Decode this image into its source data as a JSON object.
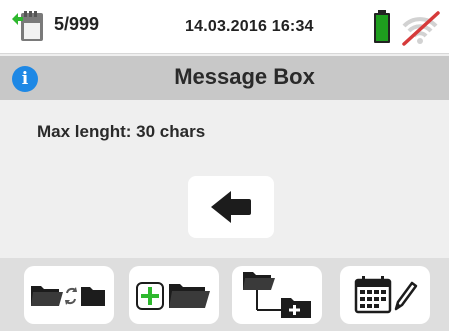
{
  "status_bar": {
    "memory_icon": "sd-card-save-icon",
    "memory_count": "5/999",
    "datetime": "14.03.2016  16:34",
    "battery_icon": "battery-full-icon",
    "battery_color": "#1e9e1e",
    "wifi_icon": "wifi-disabled-icon",
    "wifi_slash_color": "#d63a3a"
  },
  "title_bar": {
    "info_icon": "info-icon",
    "info_glyph": "i",
    "title": "Message Box"
  },
  "message": {
    "text": "Max lenght: 30 chars"
  },
  "back_button": {
    "icon": "arrow-left-icon"
  },
  "toolbar": {
    "buttons": [
      {
        "icon": "folder-swap-icon"
      },
      {
        "icon": "add-folder-icon",
        "accent": "#2eb82e"
      },
      {
        "icon": "new-subfolder-icon"
      },
      {
        "icon": "calendar-edit-icon"
      }
    ]
  }
}
